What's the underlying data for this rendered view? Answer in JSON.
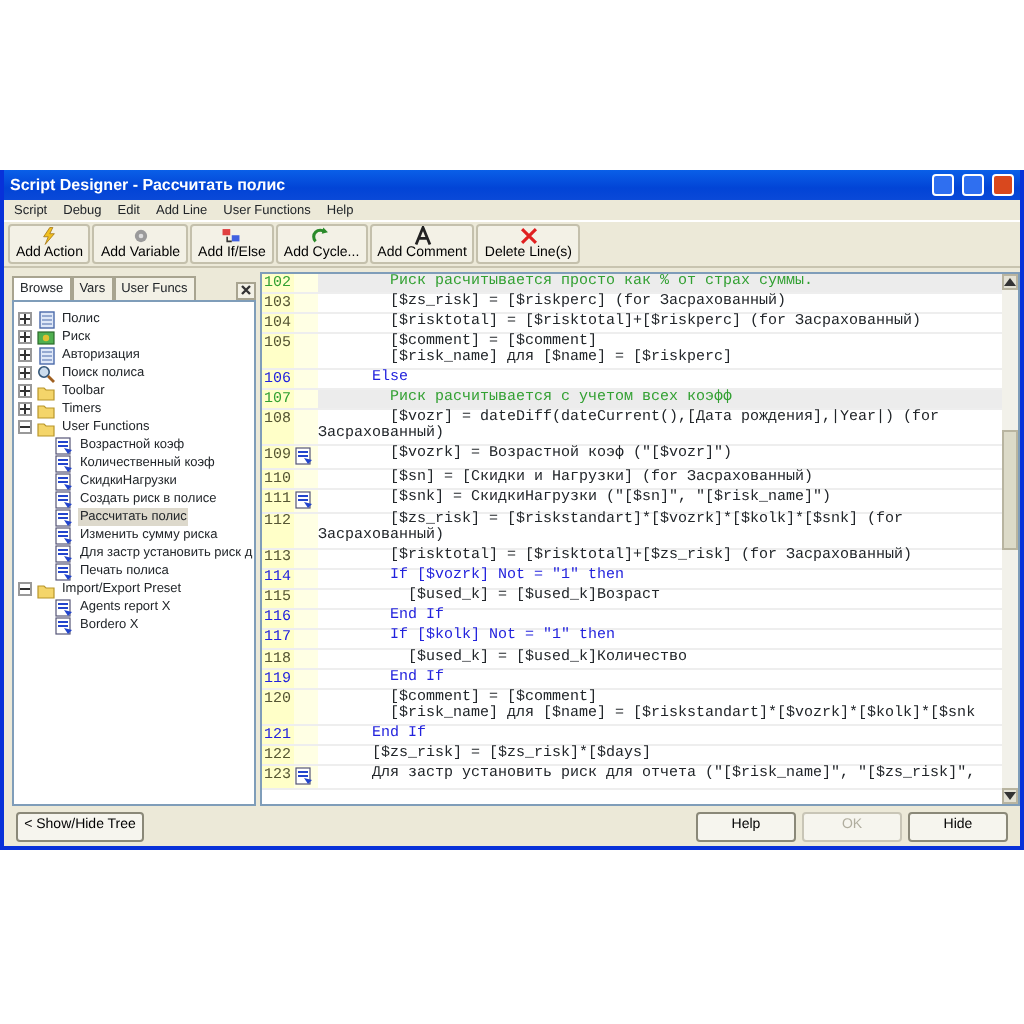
{
  "window": {
    "title": "Script Designer - Рассчитать полис"
  },
  "menu": [
    "Script",
    "Debug",
    "Edit",
    "Add Line",
    "User Functions",
    "Help"
  ],
  "toolbar": [
    {
      "label": "Add Action",
      "kind": "action"
    },
    {
      "label": "Add Variable",
      "kind": "variable"
    },
    {
      "label": "Add If/Else",
      "kind": "ifelse"
    },
    {
      "label": "Add Cycle...",
      "kind": "cycle"
    },
    {
      "label": "Add Comment",
      "kind": "comment"
    },
    {
      "label": "Delete Line(s)",
      "kind": "delete"
    }
  ],
  "tabs": [
    {
      "label": "Browse",
      "selected": true
    },
    {
      "label": "Vars",
      "selected": false
    },
    {
      "label": "User Funcs",
      "selected": false
    }
  ],
  "tree": [
    {
      "label": "Полис",
      "kind": "page",
      "expanded": false,
      "selected": false
    },
    {
      "label": "Риск",
      "kind": "money",
      "expanded": false,
      "selected": false
    },
    {
      "label": "Авторизация",
      "kind": "page",
      "expanded": false,
      "selected": false
    },
    {
      "label": "Поиск полиса",
      "kind": "search",
      "expanded": false,
      "selected": false
    },
    {
      "label": "Toolbar",
      "kind": "folder",
      "expanded": false,
      "selected": false
    },
    {
      "label": "Timers",
      "kind": "folder",
      "expanded": false,
      "selected": false
    },
    {
      "label": "User Functions",
      "kind": "folder",
      "expanded": true,
      "selected": false,
      "children": [
        {
          "label": "Возрастной коэф",
          "kind": "script",
          "selected": false
        },
        {
          "label": "Количественный коэф",
          "kind": "script",
          "selected": false
        },
        {
          "label": "СкидкиНагрузки",
          "kind": "script",
          "selected": false
        },
        {
          "label": "Создать риск в полисе",
          "kind": "script",
          "selected": false
        },
        {
          "label": "Рассчитать полис",
          "kind": "script",
          "selected": true
        },
        {
          "label": "Изменить сумму риска",
          "kind": "script",
          "selected": false
        },
        {
          "label": "Для застр установить риск д",
          "kind": "script",
          "selected": false
        },
        {
          "label": "Печать полиса",
          "kind": "script",
          "selected": false
        }
      ]
    },
    {
      "label": "Import/Export Preset",
      "kind": "folder",
      "expanded": true,
      "selected": false,
      "children": [
        {
          "label": "Agents report  X",
          "kind": "script",
          "selected": false
        },
        {
          "label": "Bordero X",
          "kind": "script",
          "selected": false
        }
      ]
    }
  ],
  "code_lines": [
    {
      "number": "102",
      "kind": "comment",
      "linked": false,
      "lines": [
        "        Риск расчитывается просто как % от страх суммы."
      ]
    },
    {
      "number": "103",
      "kind": "statement",
      "linked": false,
      "lines": [
        "        [$zs_risk] = [$riskperc] (for Засрахованный)"
      ]
    },
    {
      "number": "104",
      "kind": "statement",
      "linked": false,
      "lines": [
        "        [$risktotal] = [$risktotal]+[$riskperc] (for Засрахованный)"
      ]
    },
    {
      "number": "105",
      "kind": "statement",
      "linked": false,
      "lines": [
        "        [$comment] = [$comment]",
        "        [$risk_name] для [$name] = [$riskperc]"
      ]
    },
    {
      "number": "106",
      "kind": "keyword",
      "linked": false,
      "lines": [
        "      Else"
      ]
    },
    {
      "number": "107",
      "kind": "comment",
      "linked": false,
      "lines": [
        "        Риск расчитывается с учетом всех коэфф"
      ]
    },
    {
      "number": "108",
      "kind": "statement",
      "linked": false,
      "lines": [
        "        [$vozr] = dateDiff(dateCurrent(),[Дата рождения],|Year|) (for Засрахованный)"
      ]
    },
    {
      "number": "109",
      "kind": "statement",
      "linked": true,
      "lines": [
        "        [$vozrk] = Возрастной коэф (\"[$vozr]\")"
      ]
    },
    {
      "number": "110",
      "kind": "statement",
      "linked": false,
      "lines": [
        "        [$sn] = [Скидки и Нагрузки] (for Засрахованный)"
      ]
    },
    {
      "number": "111",
      "kind": "statement",
      "linked": true,
      "lines": [
        "        [$snk] = СкидкиНагрузки (\"[$sn]\", \"[$risk_name]\")"
      ]
    },
    {
      "number": "112",
      "kind": "statement",
      "linked": false,
      "lines": [
        "        [$zs_risk] = [$riskstandart]*[$vozrk]*[$kolk]*[$snk] (for Засрахованный)"
      ]
    },
    {
      "number": "113",
      "kind": "statement",
      "linked": false,
      "lines": [
        "        [$risktotal] = [$risktotal]+[$zs_risk] (for Засрахованный)"
      ]
    },
    {
      "number": "114",
      "kind": "keyword",
      "linked": false,
      "lines": [
        "        If [$vozrk] Not = \"1\" then"
      ]
    },
    {
      "number": "115",
      "kind": "statement",
      "linked": false,
      "lines": [
        "          [$used_k] = [$used_k]Возраст"
      ]
    },
    {
      "number": "116",
      "kind": "keyword",
      "linked": false,
      "lines": [
        "        End If"
      ]
    },
    {
      "number": "117",
      "kind": "keyword",
      "linked": false,
      "lines": [
        "        If [$kolk] Not = \"1\" then"
      ]
    },
    {
      "number": "118",
      "kind": "statement",
      "linked": false,
      "lines": [
        "          [$used_k] = [$used_k]Количество"
      ]
    },
    {
      "number": "119",
      "kind": "keyword",
      "linked": false,
      "lines": [
        "        End If"
      ]
    },
    {
      "number": "120",
      "kind": "statement",
      "linked": false,
      "lines": [
        "        [$comment] = [$comment]",
        "        [$risk_name] для [$name] = [$riskstandart]*[$vozrk]*[$kolk]*[$snk"
      ]
    },
    {
      "number": "121",
      "kind": "keyword",
      "linked": false,
      "lines": [
        "      End If"
      ]
    },
    {
      "number": "122",
      "kind": "statement",
      "linked": false,
      "lines": [
        "      [$zs_risk] = [$zs_risk]*[$days]"
      ]
    },
    {
      "number": "123",
      "kind": "statement",
      "linked": true,
      "lines": [
        "      Для застр установить риск для отчета (\"[$risk_name]\", \"[$zs_risk]\","
      ]
    }
  ],
  "bottom_buttons": [
    {
      "label": "< Show/Hide Tree",
      "kind": "left",
      "disabled": false
    },
    {
      "label": "Help",
      "kind": "right",
      "disabled": false
    },
    {
      "label": "OK",
      "kind": "right",
      "disabled": true
    },
    {
      "label": "Hide",
      "kind": "right",
      "disabled": false
    }
  ]
}
